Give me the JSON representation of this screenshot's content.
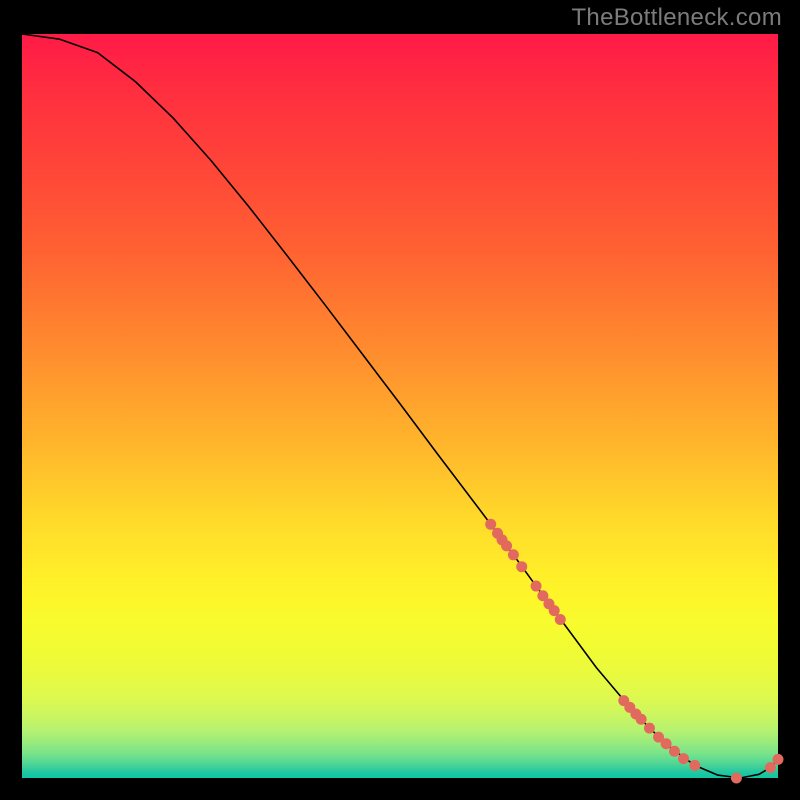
{
  "watermark": "TheBottleneck.com",
  "chart_data": {
    "type": "line",
    "title": "",
    "xlabel": "",
    "ylabel": "",
    "xlim": [
      0,
      100
    ],
    "ylim": [
      0,
      100
    ],
    "grid": false,
    "legend": false,
    "series": [
      {
        "name": "bottleneck-curve",
        "x": [
          0,
          5,
          10,
          15,
          20,
          25,
          30,
          35,
          40,
          45,
          50,
          55,
          60,
          62,
          65,
          68,
          72,
          76,
          80,
          83,
          86,
          89,
          92,
          95,
          97.5,
          99,
          100
        ],
        "y": [
          100,
          99.3,
          97.5,
          93.6,
          88.7,
          83.0,
          76.8,
          70.3,
          63.7,
          57.0,
          50.3,
          43.5,
          36.8,
          34.1,
          30.0,
          25.8,
          20.3,
          14.8,
          10.0,
          6.7,
          3.9,
          1.7,
          0.4,
          0.0,
          0.5,
          1.4,
          2.5
        ]
      }
    ],
    "scatter_markers": {
      "name": "highlight-dots",
      "color": "#e2695d",
      "radius_px": 5.5,
      "points": [
        {
          "x": 62.0,
          "y": 34.1
        },
        {
          "x": 62.9,
          "y": 32.9
        },
        {
          "x": 63.5,
          "y": 32.0
        },
        {
          "x": 64.1,
          "y": 31.2
        },
        {
          "x": 65.0,
          "y": 30.0
        },
        {
          "x": 66.1,
          "y": 28.4
        },
        {
          "x": 68.0,
          "y": 25.8
        },
        {
          "x": 68.9,
          "y": 24.5
        },
        {
          "x": 69.7,
          "y": 23.4
        },
        {
          "x": 70.4,
          "y": 22.5
        },
        {
          "x": 71.2,
          "y": 21.3
        },
        {
          "x": 79.6,
          "y": 10.4
        },
        {
          "x": 80.4,
          "y": 9.5
        },
        {
          "x": 81.2,
          "y": 8.6
        },
        {
          "x": 81.9,
          "y": 7.9
        },
        {
          "x": 83.0,
          "y": 6.7
        },
        {
          "x": 84.2,
          "y": 5.5
        },
        {
          "x": 85.2,
          "y": 4.6
        },
        {
          "x": 86.3,
          "y": 3.6
        },
        {
          "x": 87.5,
          "y": 2.6
        },
        {
          "x": 89.0,
          "y": 1.7
        },
        {
          "x": 94.5,
          "y": 0.0
        },
        {
          "x": 99.0,
          "y": 1.4
        },
        {
          "x": 100.0,
          "y": 2.5
        }
      ]
    },
    "gradient": {
      "orientation": "vertical",
      "stops": [
        {
          "pct": 0,
          "color": "#ff1a47"
        },
        {
          "pct": 30,
          "color": "#ff6432"
        },
        {
          "pct": 66,
          "color": "#ffdc2a"
        },
        {
          "pct": 83,
          "color": "#e9fa3e"
        },
        {
          "pct": 95,
          "color": "#99eb7d"
        },
        {
          "pct": 100,
          "color": "#10c5a5"
        }
      ]
    }
  }
}
